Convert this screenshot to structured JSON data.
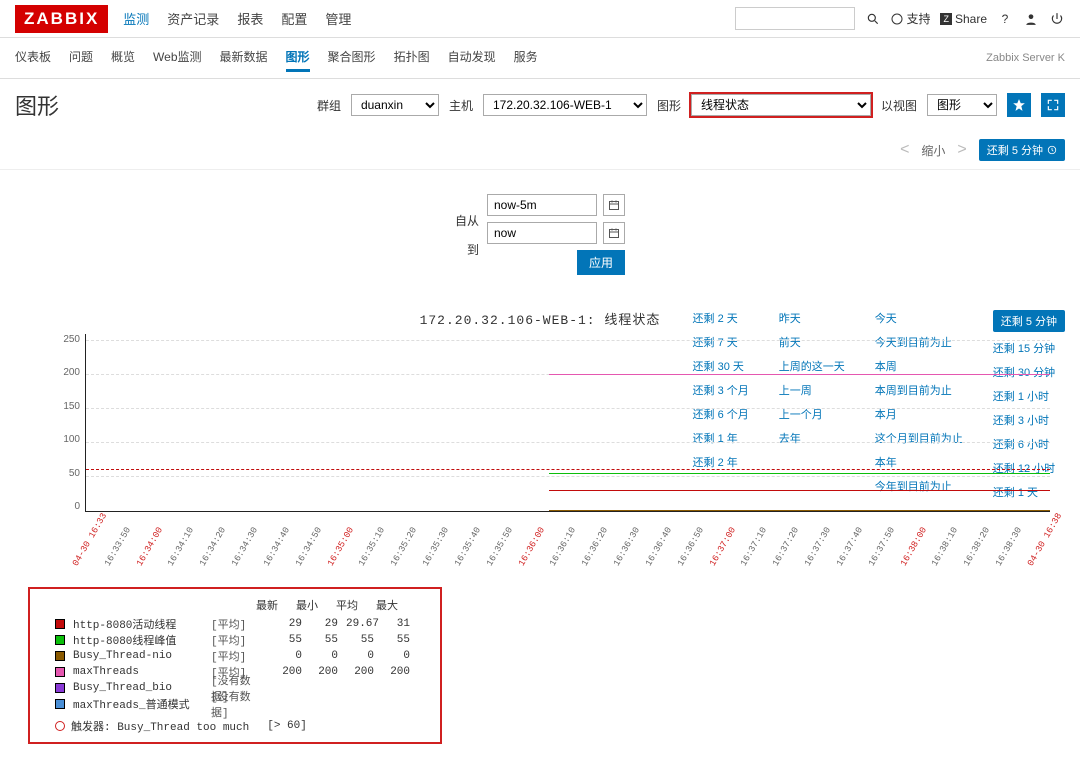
{
  "logo": "ZABBIX",
  "main_nav": [
    "监测",
    "资产记录",
    "报表",
    "配置",
    "管理"
  ],
  "header_right": {
    "support": "支持",
    "share": "Share",
    "share_badge": "Z"
  },
  "sub_nav": [
    "仪表板",
    "问题",
    "概览",
    "Web监测",
    "最新数据",
    "图形",
    "聚合图形",
    "拓扑图",
    "自动发现",
    "服务"
  ],
  "sub_nav_active_index": 5,
  "server_label": "Zabbix Server K",
  "page_title": "图形",
  "filters": {
    "group_label": "群组",
    "group_value": "duanxin",
    "host_label": "主机",
    "host_value": "172.20.32.106-WEB-1",
    "graph_label": "图形",
    "graph_value": "线程状态",
    "view_label": "以视图",
    "view_value": "图形"
  },
  "controls": {
    "zoom_out": "缩小",
    "active_range": "还剩 5 分钟"
  },
  "time_form": {
    "from_label": "自从",
    "from_value": "now-5m",
    "to_label": "到",
    "to_value": "now",
    "apply": "应用"
  },
  "presets": {
    "col1": [
      "还剩 2 天",
      "还剩 7 天",
      "还剩 30 天",
      "还剩 3 个月",
      "还剩 6 个月",
      "还剩 1 年",
      "还剩 2 年"
    ],
    "col2": [
      "昨天",
      "前天",
      "上周的这一天",
      "上一周",
      "上一个月",
      "去年"
    ],
    "col3": [
      "今天",
      "今天到目前为止",
      "本周",
      "本周到目前为止",
      "本月",
      "这个月到目前为止",
      "本年",
      "今年到目前为止"
    ],
    "col4": [
      "还剩 5 分钟",
      "还剩 15 分钟",
      "还剩 30 分钟",
      "还剩 1 小时",
      "还剩 3 小时",
      "还剩 6 小时",
      "还剩 12 小时",
      "还剩 1 天"
    ]
  },
  "chart_data": {
    "type": "line",
    "title": "172.20.32.106-WEB-1: 线程状态",
    "ylabel": "",
    "ylim": [
      0,
      260
    ],
    "y_ticks": [
      250,
      200,
      150,
      100,
      50,
      0
    ],
    "x_ticks": [
      "04-30 16:33",
      "16:33:50",
      "16:34:00",
      "16:34:10",
      "16:34:20",
      "16:34:30",
      "16:34:40",
      "16:34:50",
      "16:35:00",
      "16:35:10",
      "16:35:20",
      "16:35:30",
      "16:35:40",
      "16:35:50",
      "16:36:00",
      "16:36:10",
      "16:36:20",
      "16:36:30",
      "16:36:40",
      "16:36:50",
      "16:37:00",
      "16:37:10",
      "16:37:20",
      "16:37:30",
      "16:37:40",
      "16:37:50",
      "16:38:00",
      "16:38:10",
      "16:38:20",
      "16:38:30",
      "04-30 16:38"
    ],
    "x_red_indices": [
      0,
      2,
      8,
      14,
      20,
      26,
      30
    ],
    "data_start_frac": 0.48,
    "series": [
      {
        "name": "http-8080活动线程",
        "tag": "[平均]",
        "color": "#c20b0b",
        "last": 29,
        "min": 29,
        "avg": 29.67,
        "max": 31,
        "value": 30
      },
      {
        "name": "http-8080线程峰值",
        "tag": "[平均]",
        "color": "#0bbf0b",
        "last": 55,
        "min": 55,
        "avg": 55,
        "max": 55,
        "value": 55
      },
      {
        "name": "Busy_Thread-nio",
        "tag": "[平均]",
        "color": "#8a5a00",
        "last": 0,
        "min": 0,
        "avg": 0,
        "max": 0,
        "value": 0
      },
      {
        "name": "maxThreads",
        "tag": "[平均]",
        "color": "#e557b0",
        "last": 200,
        "min": 200,
        "avg": 200,
        "max": 200,
        "value": 200
      },
      {
        "name": "Busy_Thread_bio",
        "tag": "[没有数据]",
        "color": "#8a3ad6",
        "last": null,
        "min": null,
        "avg": null,
        "max": null,
        "value": null
      },
      {
        "name": "maxThreads_普通模式",
        "tag": "[没有数据]",
        "color": "#4a8fd6",
        "last": null,
        "min": null,
        "avg": null,
        "max": null,
        "value": null
      }
    ],
    "legend_headers": [
      "最新",
      "最小",
      "平均",
      "最大"
    ],
    "trigger_line": 60,
    "trigger_label": "触发器: Busy_Thread too much",
    "trigger_value": "[> 60]"
  }
}
